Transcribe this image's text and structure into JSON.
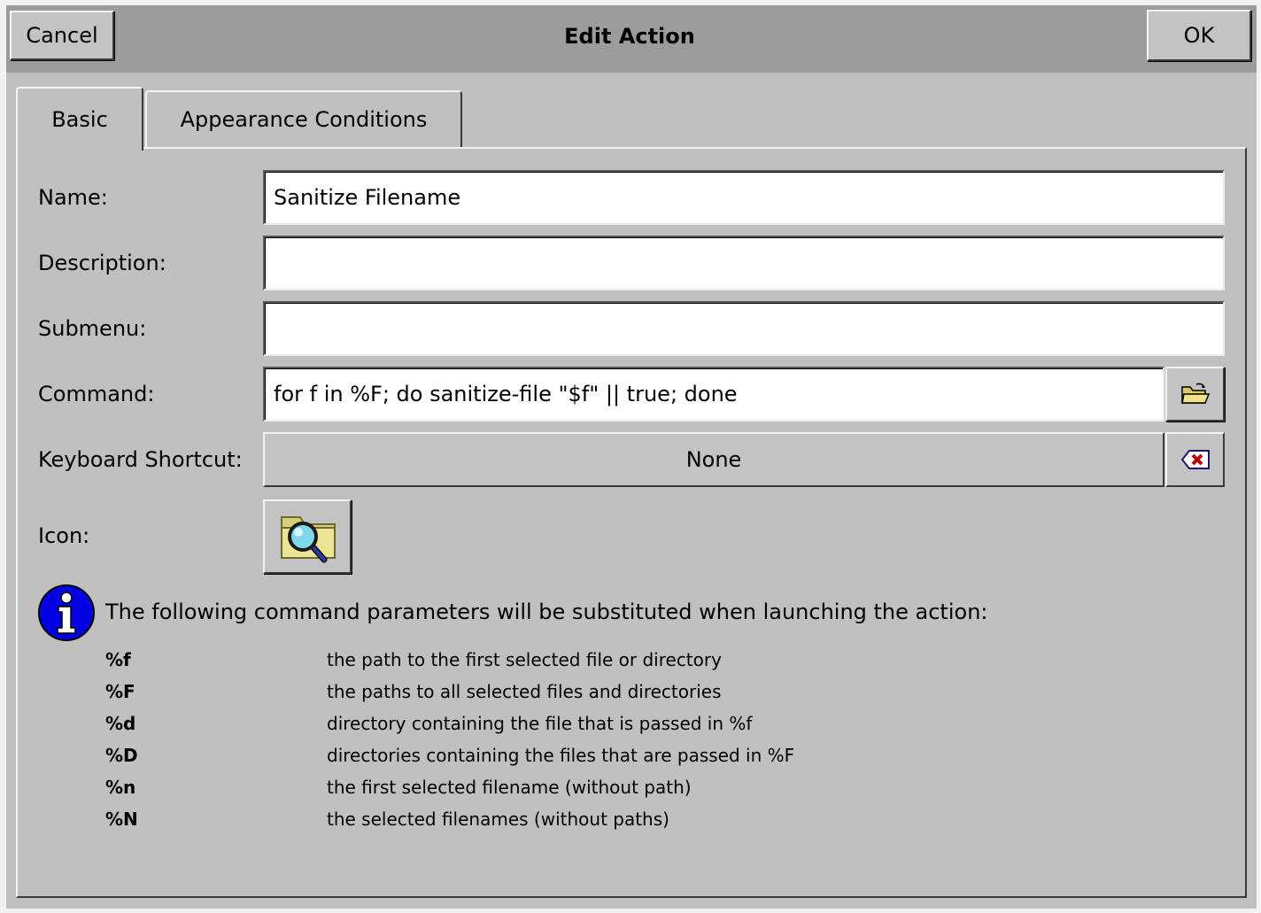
{
  "window": {
    "title": "Edit Action",
    "cancel_label": "Cancel",
    "ok_label": "OK"
  },
  "tabs": [
    {
      "label": "Basic",
      "active": true
    },
    {
      "label": "Appearance Conditions",
      "active": false
    }
  ],
  "form": {
    "name_label": "Name:",
    "name_value": "Sanitize Filename",
    "description_label": "Description:",
    "description_value": "",
    "submenu_label": "Submenu:",
    "submenu_value": "",
    "command_label": "Command:",
    "command_value": "for f in %F; do sanitize-file \"$f\" || true; done",
    "command_browse_icon": "folder-open-icon",
    "shortcut_label": "Keyboard Shortcut:",
    "shortcut_value": "None",
    "shortcut_clear_icon": "clear-backspace-icon",
    "icon_label": "Icon:",
    "icon_name": "folder-search-icon"
  },
  "info": {
    "icon": "info-icon",
    "text": "The following command parameters will be substituted when launching the action:",
    "parameters": [
      {
        "key": "%f",
        "desc": "the path to the first selected file or directory"
      },
      {
        "key": "%F",
        "desc": "the paths to all selected files and directories"
      },
      {
        "key": "%d",
        "desc": "directory containing the file that is passed in %f"
      },
      {
        "key": "%D",
        "desc": "directories containing the files that are passed in %F"
      },
      {
        "key": "%n",
        "desc": "the first selected filename (without path)"
      },
      {
        "key": "%N",
        "desc": "the selected filenames (without paths)"
      }
    ]
  }
}
